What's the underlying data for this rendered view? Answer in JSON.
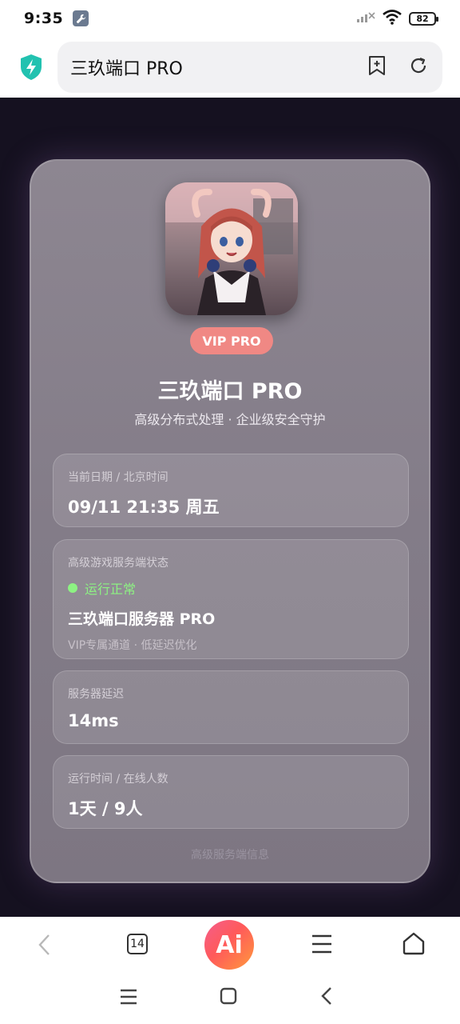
{
  "status_bar": {
    "time": "9:35",
    "battery": "82"
  },
  "browser": {
    "url_title": "三玖端口 PRO"
  },
  "card": {
    "badge": "VIP PRO",
    "title": "三玖端口 PRO",
    "subtitle": "高级分布式处理 · 企业级安全守护",
    "date_panel": {
      "label": "当前日期 / 北京时间",
      "value": "09/11 21:35 周五"
    },
    "status_panel": {
      "label": "高级游戏服务端状态",
      "status": "运行正常",
      "server_name": "三玖端口服务器 PRO",
      "description": "VIP专属通道 · 低延迟优化"
    },
    "latency_panel": {
      "label": "服务器延迟",
      "value": "14ms"
    },
    "uptime_panel": {
      "label": "运行时间 / 在线人数",
      "value": "1天 / 9人"
    },
    "footer": "高级服务端信息"
  },
  "toolbar": {
    "tabs_count": "14",
    "ai_label": "Ai"
  },
  "colors": {
    "page_bg": "#151120",
    "badge": "#f08884",
    "status_ok": "#8df283"
  }
}
